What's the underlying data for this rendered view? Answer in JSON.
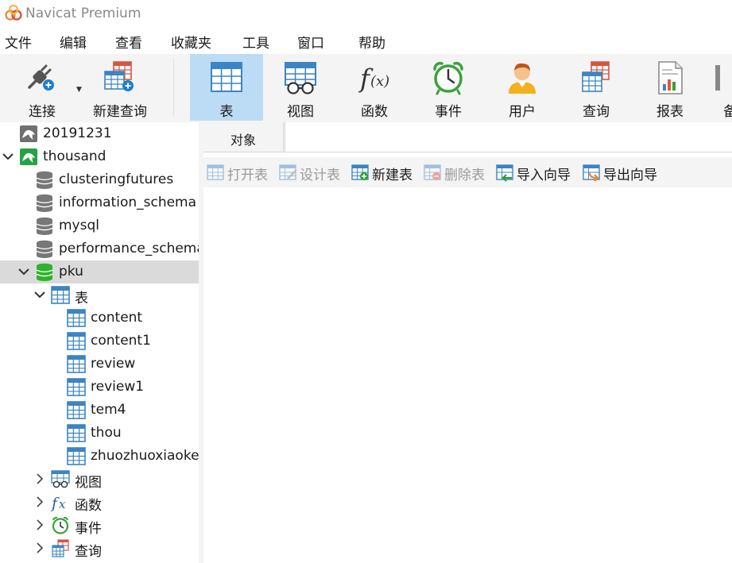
{
  "app": {
    "title": "Navicat Premium"
  },
  "menu": [
    "文件",
    "编辑",
    "查看",
    "收藏夹",
    "工具",
    "窗口",
    "帮助"
  ],
  "toolbar": {
    "connect": "连接",
    "new_query": "新建查询",
    "table": "表",
    "view": "视图",
    "function": "函数",
    "event": "事件",
    "user": "用户",
    "query": "查询",
    "report": "报表",
    "backup_partial": "备"
  },
  "tree": {
    "conn1": "20191231",
    "conn2": "thousand",
    "db1": "clusteringfutures",
    "db2": "information_schema",
    "db3": "mysql",
    "db4": "performance_schema",
    "db5": "pku",
    "tables_group": "表",
    "tables": [
      "content",
      "content1",
      "review",
      "review1",
      "tem4",
      "thou",
      "zhuozhuoxiaoke"
    ],
    "views_group": "视图",
    "functions_group": "函数",
    "events_group": "事件",
    "queries_group": "查询"
  },
  "tabs": {
    "objects": "对象"
  },
  "object_toolbar": {
    "open_table": "打开表",
    "design_table": "设计表",
    "new_table": "新建表",
    "delete_table": "删除表",
    "import_wizard": "导入向导",
    "export_wizard": "导出向导"
  },
  "colors": {
    "accent": "#bcdcf5",
    "selection": "#dadada",
    "db_active": "#2db32d",
    "table_blue": "#3c84c4",
    "conn_green": "#25a244"
  }
}
